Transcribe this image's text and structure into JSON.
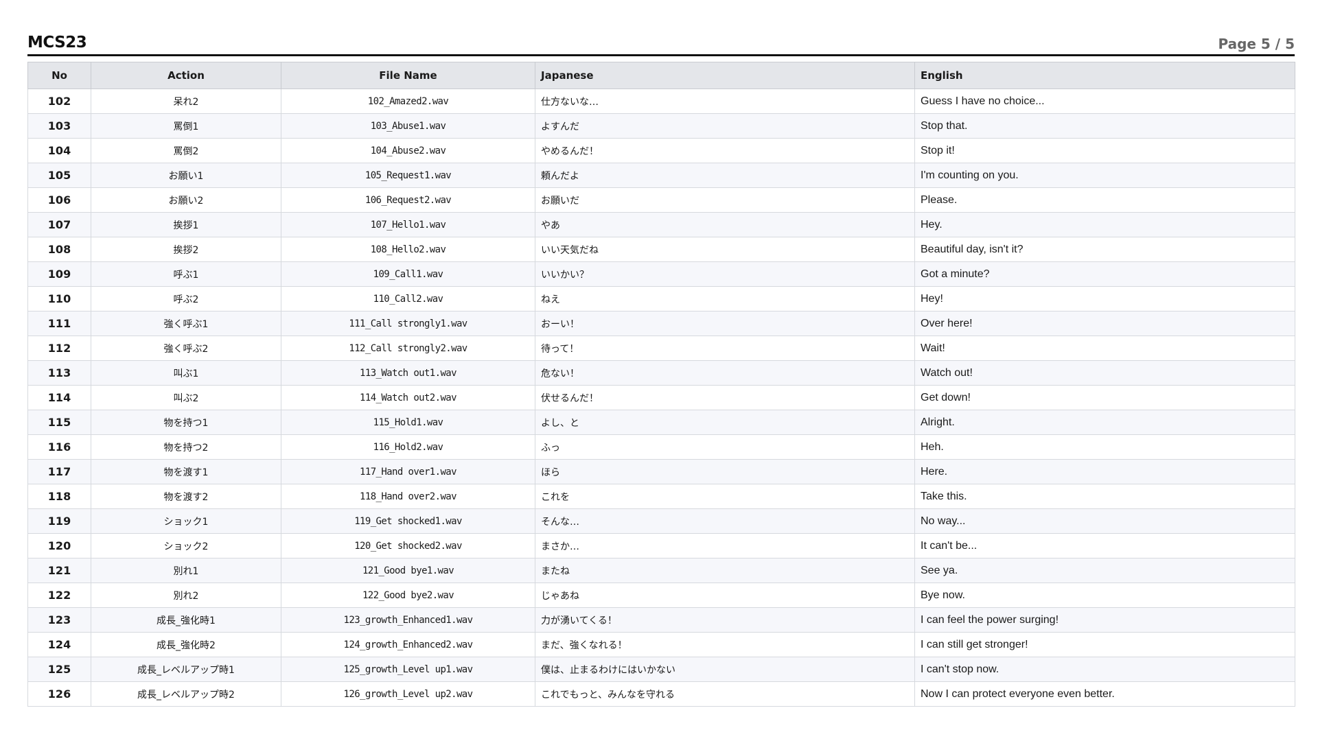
{
  "header": {
    "title": "MCS23",
    "page_indicator": "Page 5 / 5"
  },
  "table": {
    "columns": [
      "No",
      "Action",
      "File Name",
      "Japanese",
      "English"
    ],
    "rows": [
      {
        "no": "102",
        "action": "呆れ2",
        "file": "102_Amazed2.wav",
        "japanese": "仕方ないな…",
        "english": "Guess I have no choice..."
      },
      {
        "no": "103",
        "action": "罵倒1",
        "file": "103_Abuse1.wav",
        "japanese": "よすんだ",
        "english": "Stop that."
      },
      {
        "no": "104",
        "action": "罵倒2",
        "file": "104_Abuse2.wav",
        "japanese": "やめるんだ！",
        "english": "Stop it!"
      },
      {
        "no": "105",
        "action": "お願い1",
        "file": "105_Request1.wav",
        "japanese": "頼んだよ",
        "english": "I'm counting on you."
      },
      {
        "no": "106",
        "action": "お願い2",
        "file": "106_Request2.wav",
        "japanese": "お願いだ",
        "english": "Please."
      },
      {
        "no": "107",
        "action": "挨拶1",
        "file": "107_Hello1.wav",
        "japanese": "やあ",
        "english": "Hey."
      },
      {
        "no": "108",
        "action": "挨拶2",
        "file": "108_Hello2.wav",
        "japanese": "いい天気だね",
        "english": "Beautiful day, isn't it?"
      },
      {
        "no": "109",
        "action": "呼ぶ1",
        "file": "109_Call1.wav",
        "japanese": "いいかい？",
        "english": "Got a minute?"
      },
      {
        "no": "110",
        "action": "呼ぶ2",
        "file": "110_Call2.wav",
        "japanese": "ねえ",
        "english": "Hey!"
      },
      {
        "no": "111",
        "action": "強く呼ぶ1",
        "file": "111_Call strongly1.wav",
        "japanese": "おーい！",
        "english": "Over here!"
      },
      {
        "no": "112",
        "action": "強く呼ぶ2",
        "file": "112_Call strongly2.wav",
        "japanese": "待って！",
        "english": "Wait!"
      },
      {
        "no": "113",
        "action": "叫ぶ1",
        "file": "113_Watch out1.wav",
        "japanese": "危ない！",
        "english": "Watch out!"
      },
      {
        "no": "114",
        "action": "叫ぶ2",
        "file": "114_Watch out2.wav",
        "japanese": "伏せるんだ！",
        "english": "Get down!"
      },
      {
        "no": "115",
        "action": "物を持つ1",
        "file": "115_Hold1.wav",
        "japanese": "よし、と",
        "english": "Alright."
      },
      {
        "no": "116",
        "action": "物を持つ2",
        "file": "116_Hold2.wav",
        "japanese": "ふっ",
        "english": "Heh."
      },
      {
        "no": "117",
        "action": "物を渡す1",
        "file": "117_Hand over1.wav",
        "japanese": "ほら",
        "english": "Here."
      },
      {
        "no": "118",
        "action": "物を渡す2",
        "file": "118_Hand over2.wav",
        "japanese": "これを",
        "english": "Take this."
      },
      {
        "no": "119",
        "action": "ショック1",
        "file": "119_Get shocked1.wav",
        "japanese": "そんな…",
        "english": "No way..."
      },
      {
        "no": "120",
        "action": "ショック2",
        "file": "120_Get shocked2.wav",
        "japanese": "まさか…",
        "english": "It can't be..."
      },
      {
        "no": "121",
        "action": "別れ1",
        "file": "121_Good bye1.wav",
        "japanese": "またね",
        "english": "See ya."
      },
      {
        "no": "122",
        "action": "別れ2",
        "file": "122_Good bye2.wav",
        "japanese": "じゃあね",
        "english": "Bye now."
      },
      {
        "no": "123",
        "action": "成長_強化時1",
        "file": "123_growth_Enhanced1.wav",
        "japanese": "力が湧いてくる！",
        "english": "I can feel the power surging!"
      },
      {
        "no": "124",
        "action": "成長_強化時2",
        "file": "124_growth_Enhanced2.wav",
        "japanese": "まだ、強くなれる！",
        "english": "I can still get stronger!"
      },
      {
        "no": "125",
        "action": "成長_レベルアップ時1",
        "file": "125_growth_Level up1.wav",
        "japanese": "僕は、止まるわけにはいかない",
        "english": "I can't stop now."
      },
      {
        "no": "126",
        "action": "成長_レベルアップ時2",
        "file": "126_growth_Level up2.wav",
        "japanese": "これでもっと、みんなを守れる",
        "english": "Now I can protect everyone even better."
      }
    ]
  }
}
